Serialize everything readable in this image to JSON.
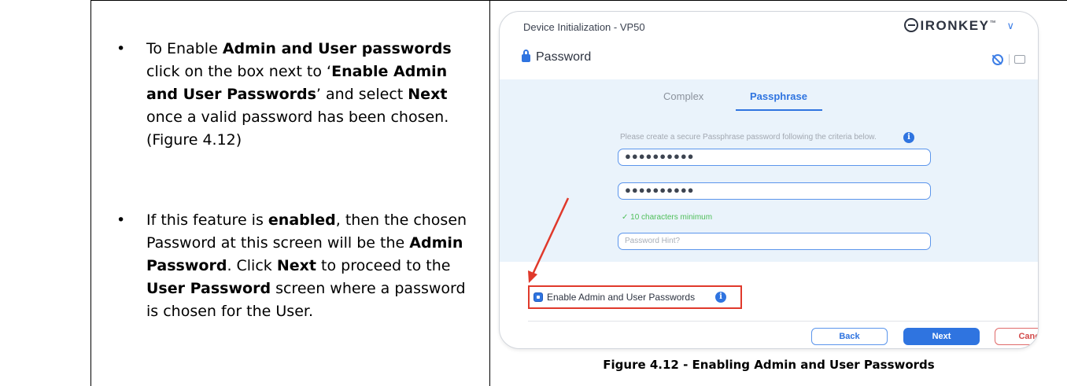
{
  "instructions": {
    "bullet1": {
      "p1": "To Enable ",
      "b1": "Admin and User passwords",
      "p2": " click on the box next to ‘",
      "b2": "Enable Admin and User Passwords",
      "p3": "’ and select ",
      "b3": "Next",
      "p4": " once a valid password has been chosen. (Figure 4.12)"
    },
    "bullet2": {
      "p1": "If this feature is ",
      "b1": "enabled",
      "p2": ", then the chosen Password at this screen will be the ",
      "b2": "Admin Password",
      "p3": ". Click ",
      "b3": "Next",
      "p4": " to proceed to the ",
      "b4": "User Password",
      "p5": " screen where a password is chosen for the User."
    },
    "bullet_glyph": "•"
  },
  "dialog": {
    "window_title": "Device Initialization - VP50",
    "brand": "IRONKEY",
    "brand_tm": "™",
    "section_title": "Password",
    "tabs": [
      {
        "label": "Complex",
        "selected": false
      },
      {
        "label": "Passphrase",
        "selected": true
      }
    ],
    "criteria_text": "Please create a secure Passphrase password following the criteria below.",
    "password_value": "●●●●●●●●●●",
    "confirm_value": "●●●●●●●●●●",
    "validation": "✓ 10 characters minimum",
    "hint_placeholder": "Password Hint?",
    "enable_label": "Enable Admin and User Passwords",
    "enable_checked": true,
    "buttons": {
      "back": "Back",
      "next": "Next",
      "cancel": "Cancel"
    },
    "accent_color": "#2f74e0",
    "highlight_color": "#e0392b"
  },
  "caption": "Figure 4.12 - Enabling Admin and User Passwords"
}
